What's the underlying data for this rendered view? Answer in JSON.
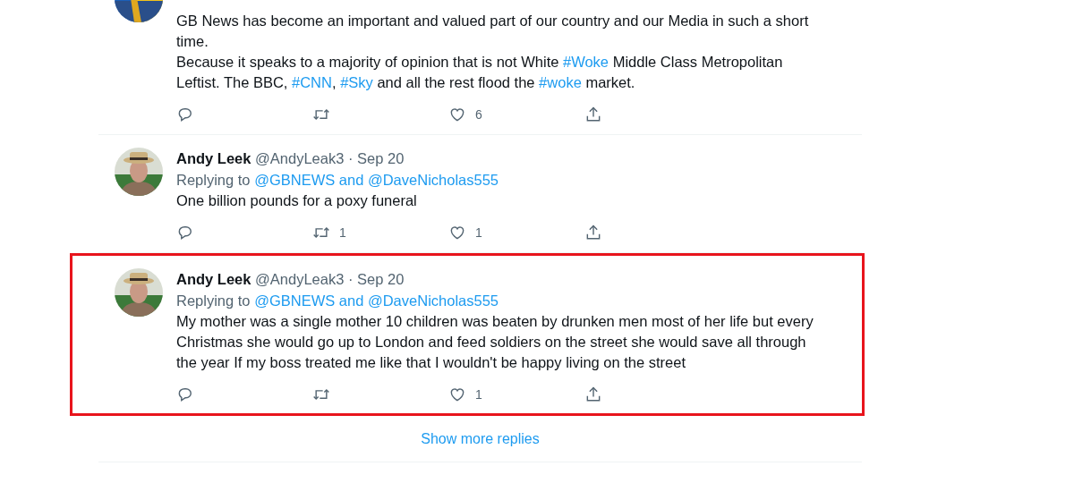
{
  "tweets": [
    {
      "highlighted": false,
      "body_lines": [
        [
          {
            "kind": "text",
            "text": "GB News has become an important and valued part of our country and our Media in such a short"
          }
        ],
        [
          {
            "kind": "text",
            "text": "time."
          }
        ],
        [
          {
            "kind": "text",
            "text": "Because it speaks to a majority of opinion that is not White "
          },
          {
            "kind": "hashtag",
            "text": "#Woke"
          },
          {
            "kind": "text",
            "text": " Middle Class Metropolitan"
          }
        ],
        [
          {
            "kind": "text",
            "text": "Leftist. The BBC, "
          },
          {
            "kind": "hashtag",
            "text": "#CNN",
            "after": ", "
          },
          {
            "kind": "hashtag",
            "text": "#Sky"
          },
          {
            "kind": "text",
            "text": " and all the rest flood the "
          },
          {
            "kind": "hashtag",
            "text": "#woke"
          },
          {
            "kind": "text",
            "text": " market."
          }
        ]
      ],
      "actions": [
        {
          "kind": "reply"
        },
        {
          "kind": "retweet"
        },
        {
          "kind": "like",
          "count": "6"
        },
        {
          "kind": "share"
        }
      ]
    },
    {
      "highlighted": false,
      "name": "Andy Leek",
      "handle": "@AndyLeak3",
      "separator": "·",
      "date": "Sep 20",
      "replying_label": "Replying to",
      "replying_to": "@GBNEWS and @DaveNicholas555",
      "body_lines": [
        [
          {
            "kind": "text",
            "text": "One billion pounds for a poxy funeral"
          }
        ]
      ],
      "actions": [
        {
          "kind": "reply"
        },
        {
          "kind": "retweet",
          "count": "1"
        },
        {
          "kind": "like",
          "count": "1"
        },
        {
          "kind": "share"
        }
      ]
    },
    {
      "highlighted": true,
      "name": "Andy Leek",
      "handle": "@AndyLeak3",
      "separator": "·",
      "date": "Sep 20",
      "replying_label": "Replying to",
      "replying_to": "@GBNEWS and @DaveNicholas555",
      "body_lines": [
        [
          {
            "kind": "text",
            "text": "My mother was a single mother 10 children was beaten by drunken men most of her life but every"
          }
        ],
        [
          {
            "kind": "text",
            "text": "Christmas she would go up to London and feed soldiers on the street she would save all through"
          }
        ],
        [
          {
            "kind": "text",
            "text": "the year If my boss treated me like that I wouldn't be happy living on the street"
          }
        ]
      ],
      "actions": [
        {
          "kind": "reply"
        },
        {
          "kind": "retweet"
        },
        {
          "kind": "like",
          "count": "1"
        },
        {
          "kind": "share"
        }
      ]
    }
  ],
  "show_more": "Show more replies"
}
